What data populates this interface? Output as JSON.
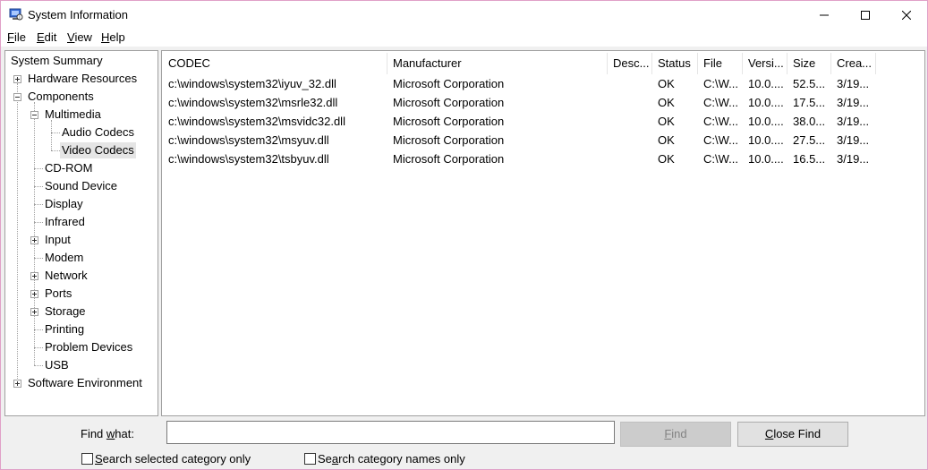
{
  "window": {
    "title": "System Information",
    "controls": {
      "minimize": "─",
      "maximize": "☐",
      "close": "✕"
    }
  },
  "menu": [
    {
      "label": "File",
      "mnemonic": "F",
      "rest": "ile"
    },
    {
      "label": "Edit",
      "mnemonic": "E",
      "rest": "dit"
    },
    {
      "label": "View",
      "mnemonic": "V",
      "rest": "iew"
    },
    {
      "label": "Help",
      "mnemonic": "H",
      "rest": "elp"
    }
  ],
  "tree": [
    {
      "label": "System Summary",
      "expander": "none"
    },
    {
      "label": "Hardware Resources",
      "expander": "plus"
    },
    {
      "label": "Components",
      "expander": "minus"
    },
    {
      "label": "Multimedia",
      "expander": "minus"
    },
    {
      "label": "Audio Codecs",
      "expander": "none"
    },
    {
      "label": "Video Codecs",
      "expander": "none",
      "selected": true
    },
    {
      "label": "CD-ROM",
      "expander": "none"
    },
    {
      "label": "Sound Device",
      "expander": "none"
    },
    {
      "label": "Display",
      "expander": "none"
    },
    {
      "label": "Infrared",
      "expander": "none"
    },
    {
      "label": "Input",
      "expander": "plus"
    },
    {
      "label": "Modem",
      "expander": "none"
    },
    {
      "label": "Network",
      "expander": "plus"
    },
    {
      "label": "Ports",
      "expander": "plus"
    },
    {
      "label": "Storage",
      "expander": "plus"
    },
    {
      "label": "Printing",
      "expander": "none"
    },
    {
      "label": "Problem Devices",
      "expander": "none"
    },
    {
      "label": "USB",
      "expander": "none"
    },
    {
      "label": "Software Environment",
      "expander": "plus"
    }
  ],
  "table": {
    "columns": [
      "CODEC",
      "Manufacturer",
      "Desc...",
      "Status",
      "File",
      "Versi...",
      "Size",
      "Crea..."
    ],
    "rows": [
      [
        "c:\\windows\\system32\\iyuv_32.dll",
        "Microsoft Corporation",
        "",
        "OK",
        "C:\\W...",
        "10.0....",
        "52.5...",
        "3/19..."
      ],
      [
        "c:\\windows\\system32\\msrle32.dll",
        "Microsoft Corporation",
        "",
        "OK",
        "C:\\W...",
        "10.0....",
        "17.5...",
        "3/19..."
      ],
      [
        "c:\\windows\\system32\\msvidc32.dll",
        "Microsoft Corporation",
        "",
        "OK",
        "C:\\W...",
        "10.0....",
        "38.0...",
        "3/19..."
      ],
      [
        "c:\\windows\\system32\\msyuv.dll",
        "Microsoft Corporation",
        "",
        "OK",
        "C:\\W...",
        "10.0....",
        "27.5...",
        "3/19..."
      ],
      [
        "c:\\windows\\system32\\tsbyuv.dll",
        "Microsoft Corporation",
        "",
        "OK",
        "C:\\W...",
        "10.0....",
        "16.5...",
        "3/19..."
      ]
    ]
  },
  "find": {
    "label_pre": "Find ",
    "label_mnemonic": "w",
    "label_post": "hat:",
    "value": "",
    "find_button": {
      "mnemonic": "F",
      "rest": "ind"
    },
    "close_find_button": {
      "mnemonic": "C",
      "rest": "lose Find"
    },
    "search_selected": {
      "mnemonic": "S",
      "rest": "earch selected category only",
      "checked": false
    },
    "search_names": {
      "pre": "Se",
      "mnemonic": "a",
      "rest": "rch category names only",
      "checked": false
    }
  }
}
